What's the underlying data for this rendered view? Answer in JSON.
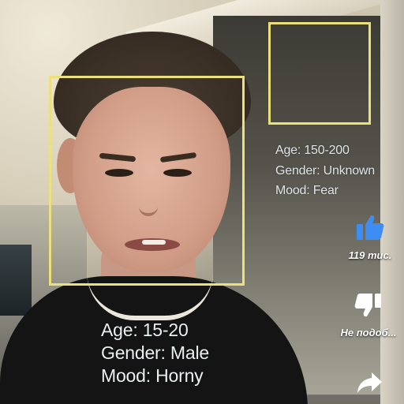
{
  "overlay": {
    "subject_1": {
      "age": "Age: 15-20",
      "gender": "Gender: Male",
      "mood": "Mood: Horny"
    },
    "subject_2": {
      "age": "Age: 150-200",
      "gender": "Gender: Unknown",
      "mood": "Mood: Fear"
    },
    "box_color": "#ebe07a"
  },
  "actions": {
    "like": {
      "icon": "thumbs-up-icon",
      "count": "119 тис.",
      "color": "#3d8df5"
    },
    "dislike": {
      "icon": "thumbs-down-icon",
      "label": "Не подоб..."
    },
    "share": {
      "icon": "share-arrow-icon"
    }
  }
}
